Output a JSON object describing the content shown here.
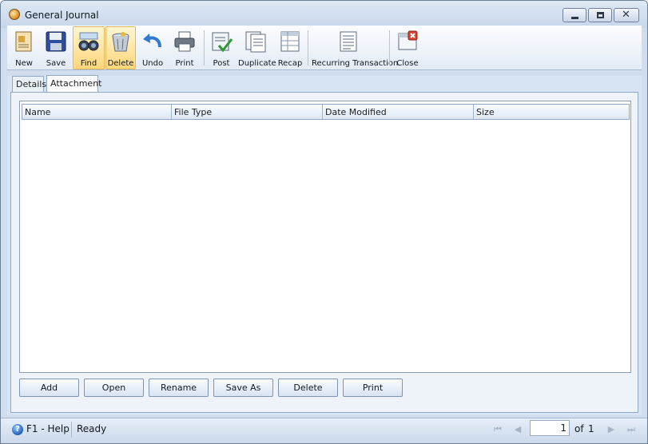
{
  "window": {
    "title": "General Journal"
  },
  "toolbar": {
    "buttons": [
      {
        "label": "New",
        "icon": "new-document-icon"
      },
      {
        "label": "Save",
        "icon": "floppy-disk-icon"
      },
      {
        "label": "Find",
        "icon": "binoculars-icon"
      },
      {
        "label": "Delete",
        "icon": "trash-bin-icon"
      },
      {
        "label": "Undo",
        "icon": "undo-arrow-icon"
      },
      {
        "label": "Print",
        "icon": "printer-icon"
      },
      {
        "label": "Post",
        "icon": "post-check-icon"
      },
      {
        "label": "Duplicate",
        "icon": "duplicate-icon"
      },
      {
        "label": "Recap",
        "icon": "recap-grid-icon"
      },
      {
        "label": "Recurring Transaction",
        "icon": "recurring-transaction-icon"
      },
      {
        "label": "Close",
        "icon": "close-window-icon"
      }
    ]
  },
  "tabs": [
    {
      "label": "Details"
    },
    {
      "label": "Attachment"
    }
  ],
  "attachments": {
    "columns": [
      "Name",
      "File Type",
      "Date Modified",
      "Size"
    ],
    "rows": []
  },
  "actions": {
    "add": "Add",
    "open": "Open",
    "rename": "Rename",
    "save_as": "Save As",
    "delete": "Delete",
    "print": "Print"
  },
  "status": {
    "help": "F1 - Help",
    "state": "Ready",
    "page_current": "1",
    "page_of": "of",
    "page_total": "1"
  },
  "colors": {
    "window_bg": "#cfddee",
    "active_button": "#ffd77a",
    "accent_blue": "#1f5fb8"
  }
}
